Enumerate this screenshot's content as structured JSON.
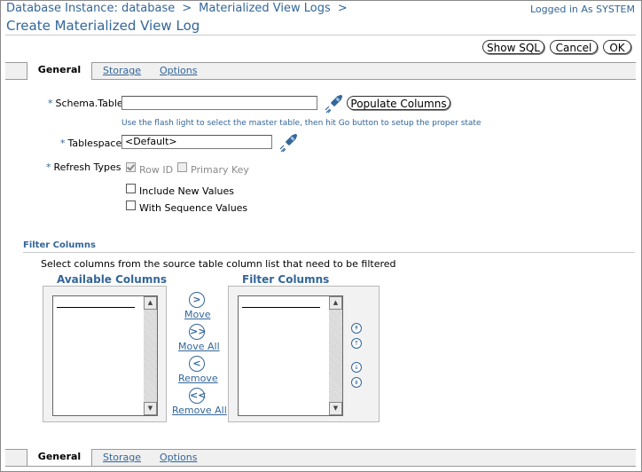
{
  "header": {
    "breadcrumb": [
      "Database Instance: database",
      "Materialized View Logs"
    ],
    "breadcrumb_separator": ">",
    "logged_in": "Logged in As SYSTEM",
    "page_title": "Create Materialized View Log"
  },
  "actions": {
    "show_sql": "Show SQL",
    "cancel": "Cancel",
    "ok": "OK"
  },
  "tabs": [
    "General",
    "Storage",
    "Options"
  ],
  "active_tab": "General",
  "form": {
    "required_marker": "*",
    "schema_table": {
      "label": "Schema.Table",
      "value": ""
    },
    "populate_columns": "Populate Columns",
    "hint": "Use the flash light to select the master table, then hit Go button to setup the proper state",
    "tablespace": {
      "label": "Tablespace",
      "value": "<Default>"
    },
    "refresh_types": {
      "label": "Refresh Types",
      "row_id": {
        "label": "Row ID",
        "checked": true,
        "disabled": true
      },
      "primary_key": {
        "label": "Primary Key",
        "checked": false,
        "disabled": true
      }
    },
    "include_new_values": {
      "label": "Include New Values",
      "checked": false
    },
    "with_sequence_values": {
      "label": "With Sequence Values",
      "checked": false
    }
  },
  "filter_columns": {
    "section_title": "Filter Columns",
    "description": "Select columns from the source table column list that need to be filtered",
    "available_title": "Available Columns",
    "filter_title": "Filter Columns",
    "move": "Move",
    "move_all": "Move All",
    "remove": "Remove",
    "remove_all": "Remove All"
  },
  "icons": {
    "flashlight": "flashlight-icon",
    "move": "chevron-right-icon",
    "move_all": "double-chevron-right-icon",
    "remove": "chevron-left-icon",
    "remove_all": "double-chevron-left-icon",
    "move_top": "move-top-icon",
    "move_up": "move-up-icon",
    "move_down": "move-down-icon",
    "move_bottom": "move-bottom-icon"
  },
  "colors": {
    "accent": "#336699",
    "tab_bar": "#f0f0f0"
  }
}
